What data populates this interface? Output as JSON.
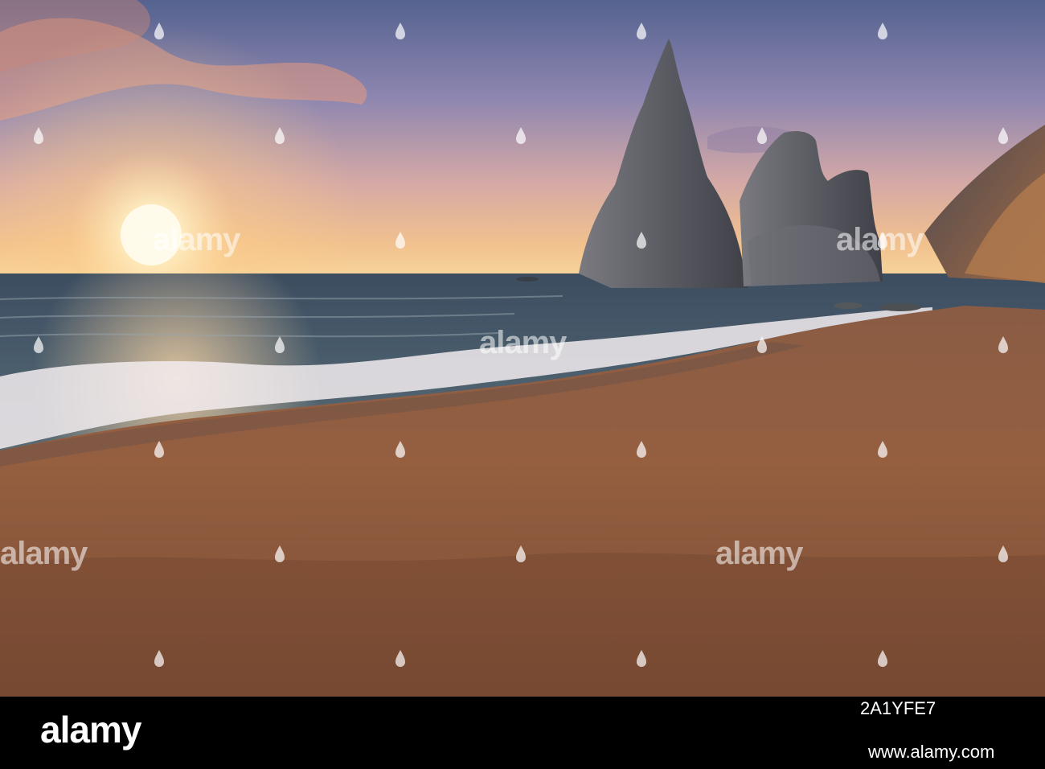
{
  "photo": {
    "scene": "sunset-beach-sea-stacks",
    "colors": {
      "sky_top": "#5f6e9e",
      "sky_mid": "#b69fb8",
      "horizon": "#f5c58a",
      "sun": "#fff6d8",
      "sea": "#3f5566",
      "foam": "#f2ecef",
      "sand_wet": "#6a4c3e",
      "sand": "#8f5e43",
      "sand_dark": "#6d432f",
      "rock": "#52525a",
      "cliff": "#8a5a3c"
    }
  },
  "watermarks": {
    "brand": "alamy",
    "icon": "alamy-drop-icon"
  },
  "footer": {
    "logo": "alamy",
    "image_id": "2A1YFE7",
    "url": "www.alamy.com"
  }
}
